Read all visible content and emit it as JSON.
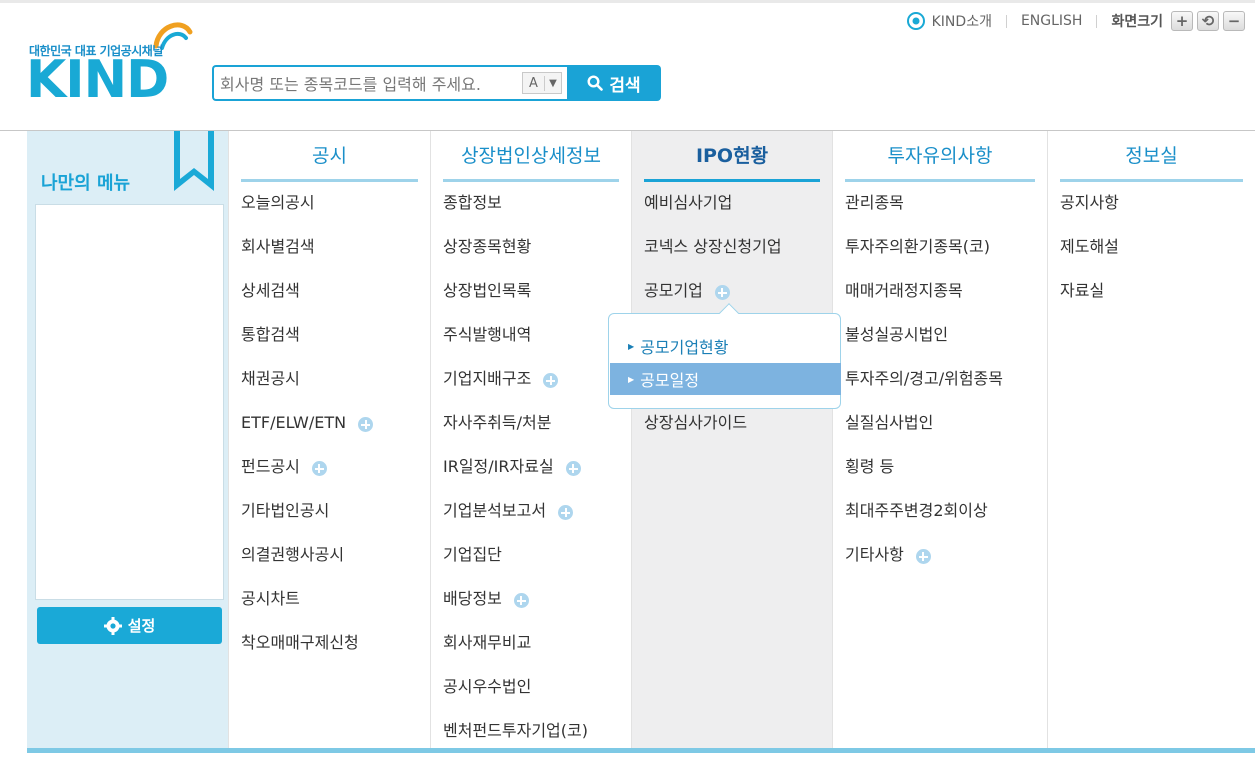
{
  "header": {
    "logo_tagline": "대한민국 대표 기업공시채널",
    "logo_text": "KIND",
    "search_placeholder": "회사명 또는 종목코드를 입력해 주세요.",
    "search_type": "A",
    "search_button": "검색",
    "util": {
      "kind_intro": "KIND소개",
      "english": "ENGLISH",
      "screen_size": "화면크기",
      "zoom_in": "+",
      "reset": "⟲",
      "zoom_out": "−"
    }
  },
  "mymenu": {
    "title": "나만의 메뉴",
    "setting_label": "설정"
  },
  "columns": [
    {
      "title": "공시",
      "items": [
        {
          "label": "오늘의공시",
          "plus": false
        },
        {
          "label": "회사별검색",
          "plus": false
        },
        {
          "label": "상세검색",
          "plus": false
        },
        {
          "label": "통합검색",
          "plus": false
        },
        {
          "label": "채권공시",
          "plus": false
        },
        {
          "label": "ETF/ELW/ETN",
          "plus": true
        },
        {
          "label": "펀드공시",
          "plus": true
        },
        {
          "label": "기타법인공시",
          "plus": false
        },
        {
          "label": "의결권행사공시",
          "plus": false
        },
        {
          "label": "공시차트",
          "plus": false
        },
        {
          "label": "착오매매구제신청",
          "plus": false
        }
      ]
    },
    {
      "title": "상장법인상세정보",
      "items": [
        {
          "label": "종합정보",
          "plus": false
        },
        {
          "label": "상장종목현황",
          "plus": false
        },
        {
          "label": "상장법인목록",
          "plus": false
        },
        {
          "label": "주식발행내역",
          "plus": false
        },
        {
          "label": "기업지배구조",
          "plus": true
        },
        {
          "label": "자사주취득/처분",
          "plus": false
        },
        {
          "label": "IR일정/IR자료실",
          "plus": true
        },
        {
          "label": "기업분석보고서",
          "plus": true
        },
        {
          "label": "기업집단",
          "plus": false
        },
        {
          "label": "배당정보",
          "plus": true
        },
        {
          "label": "회사재무비교",
          "plus": false
        },
        {
          "label": "공시우수법인",
          "plus": false
        },
        {
          "label": "벤처펀드투자기업(코)",
          "plus": false
        }
      ]
    },
    {
      "title": "IPO현황",
      "items": [
        {
          "label": "예비심사기업",
          "plus": false
        },
        {
          "label": "코넥스 상장신청기업",
          "plus": false
        },
        {
          "label": "공모기업",
          "plus": true
        },
        {
          "label": "",
          "plus": false
        },
        {
          "label": "",
          "plus": false
        },
        {
          "label": "상장심사가이드",
          "plus": false
        }
      ]
    },
    {
      "title": "투자유의사항",
      "items": [
        {
          "label": "관리종목",
          "plus": false
        },
        {
          "label": "투자주의환기종목(코)",
          "plus": false
        },
        {
          "label": "매매거래정지종목",
          "plus": false
        },
        {
          "label": "불성실공시법인",
          "plus": false
        },
        {
          "label": "투자주의/경고/위험종목",
          "plus": false
        },
        {
          "label": "실질심사법인",
          "plus": false
        },
        {
          "label": "횡령 등",
          "plus": false
        },
        {
          "label": "최대주주변경2회이상",
          "plus": false
        },
        {
          "label": "기타사항",
          "plus": true
        }
      ]
    },
    {
      "title": "정보실",
      "items": [
        {
          "label": "공지사항",
          "plus": false
        },
        {
          "label": "제도해설",
          "plus": false
        },
        {
          "label": "자료실",
          "plus": false
        }
      ]
    }
  ],
  "submenu": {
    "items": [
      "공모기업현황",
      "공모일정"
    ],
    "highlighted": "공모일정"
  },
  "colors": {
    "accent": "#1aa3d6",
    "mymenu_bg": "#dceef6",
    "highlight": "#7db3e0"
  }
}
